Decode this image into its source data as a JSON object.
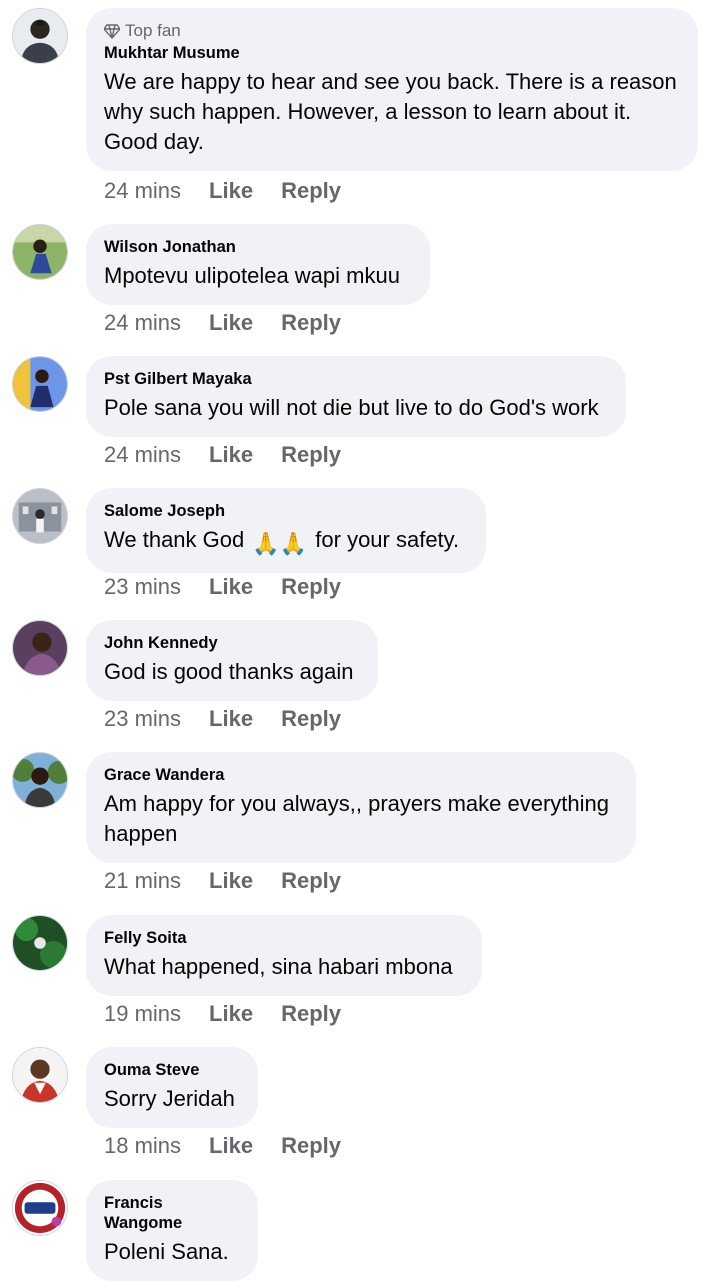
{
  "actions": {
    "like": "Like",
    "reply": "Reply"
  },
  "badge_top_fan": "Top fan",
  "comments": [
    {
      "name": "Mukhtar Musume",
      "badge": "Top fan",
      "text": "We are happy to hear and see you back. There is a reason why such happen. However, a lesson to learn about it. Good day.",
      "time": "24 mins",
      "avatar_icon": "person-dark-photo",
      "avatar_color": "#3a3f4a"
    },
    {
      "name": "Wilson Jonathan",
      "text": "Mpotevu ulipotelea wapi mkuu",
      "time": "24 mins",
      "avatar_icon": "outdoor-green-photo",
      "avatar_color": "#6a9a3e"
    },
    {
      "name": "Pst Gilbert Mayaka",
      "text": "Pole sana you will not die but live to do God's work",
      "time": "24 mins",
      "avatar_icon": "stage-blue-photo",
      "avatar_color": "#3b6fd6"
    },
    {
      "name": "Salome Joseph",
      "text_before": "We thank God",
      "emoji": "🙏🙏",
      "text_after": "for your safety.",
      "time": "23 mins",
      "avatar_icon": "building-gray-photo",
      "avatar_color": "#9aa1ab"
    },
    {
      "name": "John Kennedy",
      "text": "God is good thanks again",
      "time": "23 mins",
      "avatar_icon": "portrait-purple-photo",
      "avatar_color": "#7b4a78"
    },
    {
      "name": "Grace Wandera",
      "text": "Am happy for you always,, prayers make everything happen",
      "time": "21 mins",
      "avatar_icon": "portrait-trees-photo",
      "avatar_color": "#4f7f3a"
    },
    {
      "name": "Felly Soita",
      "text": "What  happened, sina habari mbona",
      "time": "19 mins",
      "avatar_icon": "green-foliage-photo",
      "avatar_color": "#1f6b2a"
    },
    {
      "name": "Ouma Steve",
      "text": "Sorry Jeridah",
      "time": "18 mins",
      "avatar_icon": "portrait-red-photo",
      "avatar_color": "#c8352b"
    },
    {
      "name": "Francis Wangome",
      "text": "Poleni Sana.",
      "avatar_icon": "kurunzi-insha-logo",
      "avatar_color": "#b4232a"
    }
  ]
}
